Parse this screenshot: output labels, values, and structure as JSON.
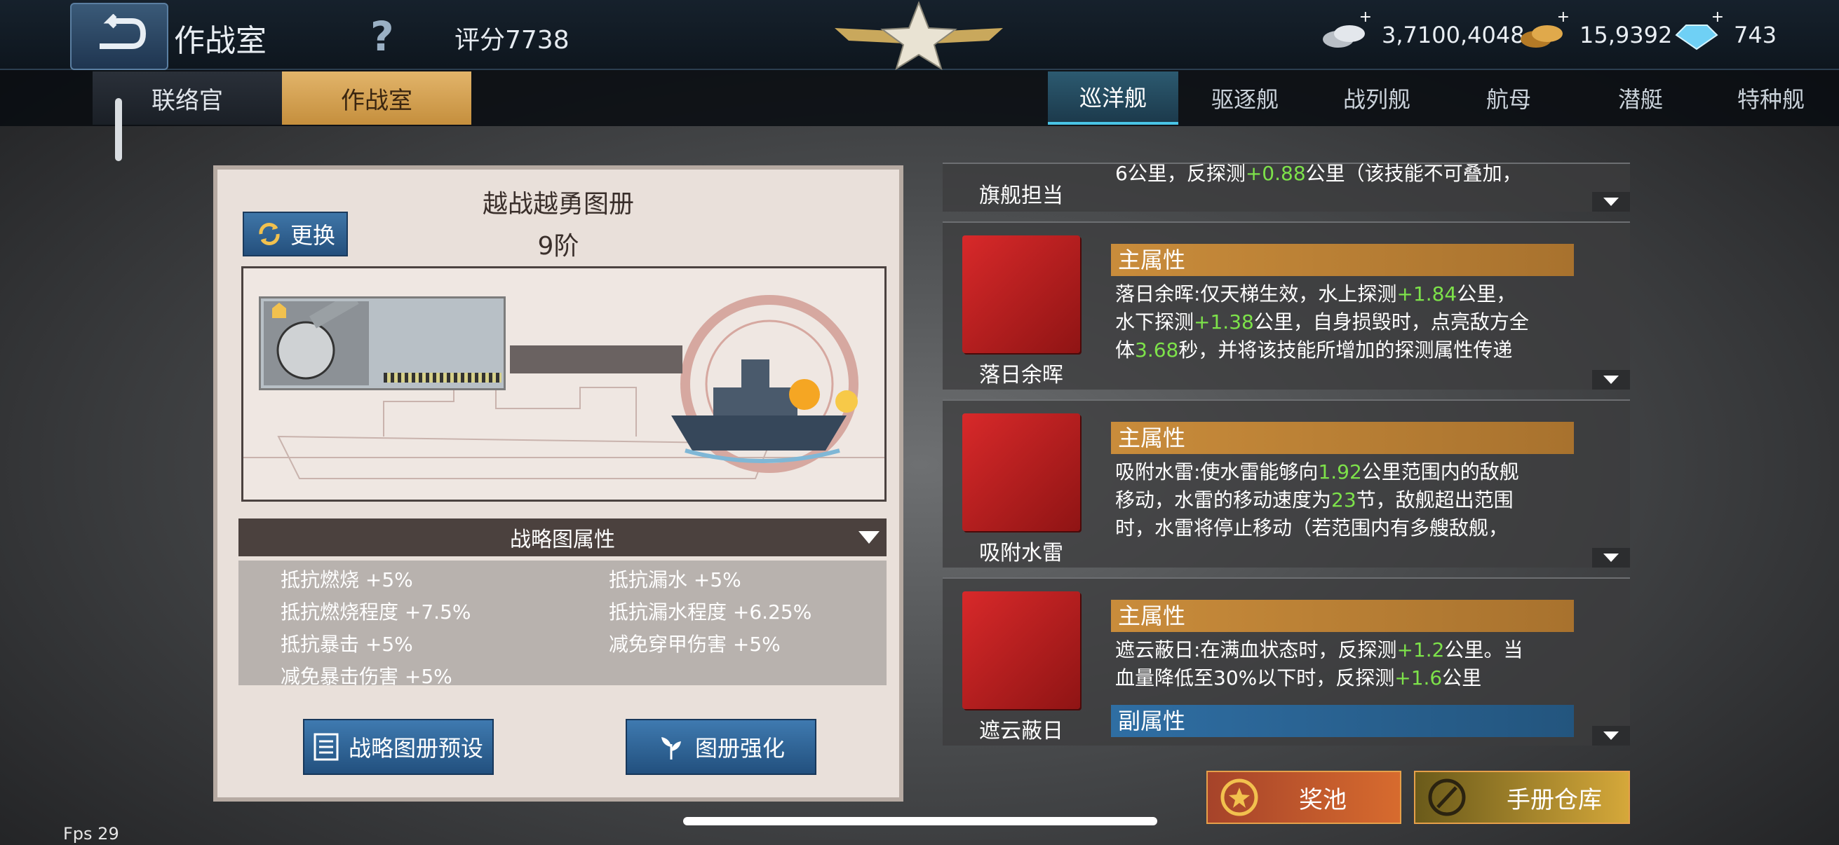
{
  "header": {
    "title": "作战室",
    "score": "评分7738",
    "currencies": [
      {
        "name": "silver-coins-icon",
        "value": "3,7100,4048"
      },
      {
        "name": "gold-coins-icon",
        "value": "15,9392"
      },
      {
        "name": "diamond-icon",
        "value": "743"
      }
    ]
  },
  "left_tabs": [
    "联络官",
    "作战室"
  ],
  "ship_tabs": [
    "巡洋舰",
    "驱逐舰",
    "战列舰",
    "航母",
    "潜艇",
    "特种舰"
  ],
  "panel": {
    "title": "越战越勇图册",
    "tier": "9阶",
    "swap_label": "更换",
    "attr_header": "战略图属性",
    "attrs_left": [
      "抵抗燃烧 +5%",
      "抵抗燃烧程度 +7.5%",
      "抵抗暴击 +5%",
      "减免暴击伤害 +5%"
    ],
    "attrs_right": [
      "抵抗漏水 +5%",
      "抵抗漏水程度 +6.25%",
      "减免穿甲伤害 +5%"
    ],
    "preset_label": "战略图册预设",
    "enhance_label": "图册强化"
  },
  "cards": {
    "top_partial": {
      "name": "旗舰担当",
      "desc_a": "6公里，反探测",
      "desc_g": "+0.88",
      "desc_b": "公里（该技能不可叠加，"
    },
    "c1": {
      "head": "主属性",
      "name": "落日余晖",
      "l1a": "落日余晖:仅天梯生效，水上探测",
      "l1g": "+1.84",
      "l1b": "公里，",
      "l2a": "水下探测",
      "l2g": "+1.38",
      "l2b": "公里，自身损毁时，点亮敌方全",
      "l3a": "体",
      "l3g": "3.68",
      "l3b": "秒，并将该技能所增加的探测属性传递"
    },
    "c2": {
      "head": "主属性",
      "name": "吸附水雷",
      "l1a": "吸附水雷:使水雷能够向",
      "l1g": "1.92",
      "l1b": "公里范围内的敌舰",
      "l2a": "移动，水雷的移动速度为",
      "l2g": "23",
      "l2b": "节，敌舰超出范围",
      "l3": "时，水雷将停止移动（若范围内有多艘敌舰，"
    },
    "c3": {
      "head": "主属性",
      "sub_head": "副属性",
      "name": "遮云蔽日",
      "l1a": "遮云蔽日:在满血状态时，反探测",
      "l1g": "+1.2",
      "l1b": "公里。当",
      "l2a": "血量降低至30%以下时，反探测",
      "l2g": "+1.6",
      "l2b": "公里"
    }
  },
  "bottom": {
    "reward_pool": "奖池",
    "manual_storage": "手册仓库"
  },
  "fps": "Fps 29"
}
